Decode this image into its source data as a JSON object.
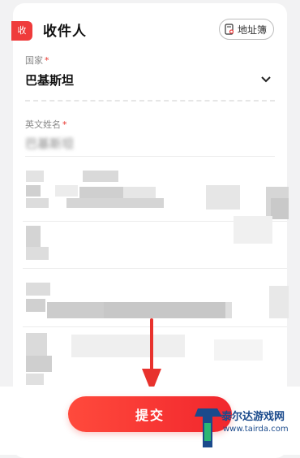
{
  "header": {
    "tag": "收",
    "title": "收件人",
    "address_book": "地址簿"
  },
  "country": {
    "label": "国家",
    "required": "*",
    "value": "巴基斯坦"
  },
  "english_name": {
    "label": "英文姓名",
    "required": "*",
    "value": "巴基斯坦"
  },
  "submit": {
    "label": "提交"
  },
  "watermark": {
    "name": "泰尔达游戏网",
    "url": "www.tairda.com"
  },
  "colors": {
    "accent": "#ef3b3b",
    "submit": "#f1262d",
    "watermark": "#1a4a8c"
  },
  "icons": [
    "address-book-icon",
    "chevron-down-icon",
    "arrow-down-icon",
    "watermark-logo-icon"
  ]
}
